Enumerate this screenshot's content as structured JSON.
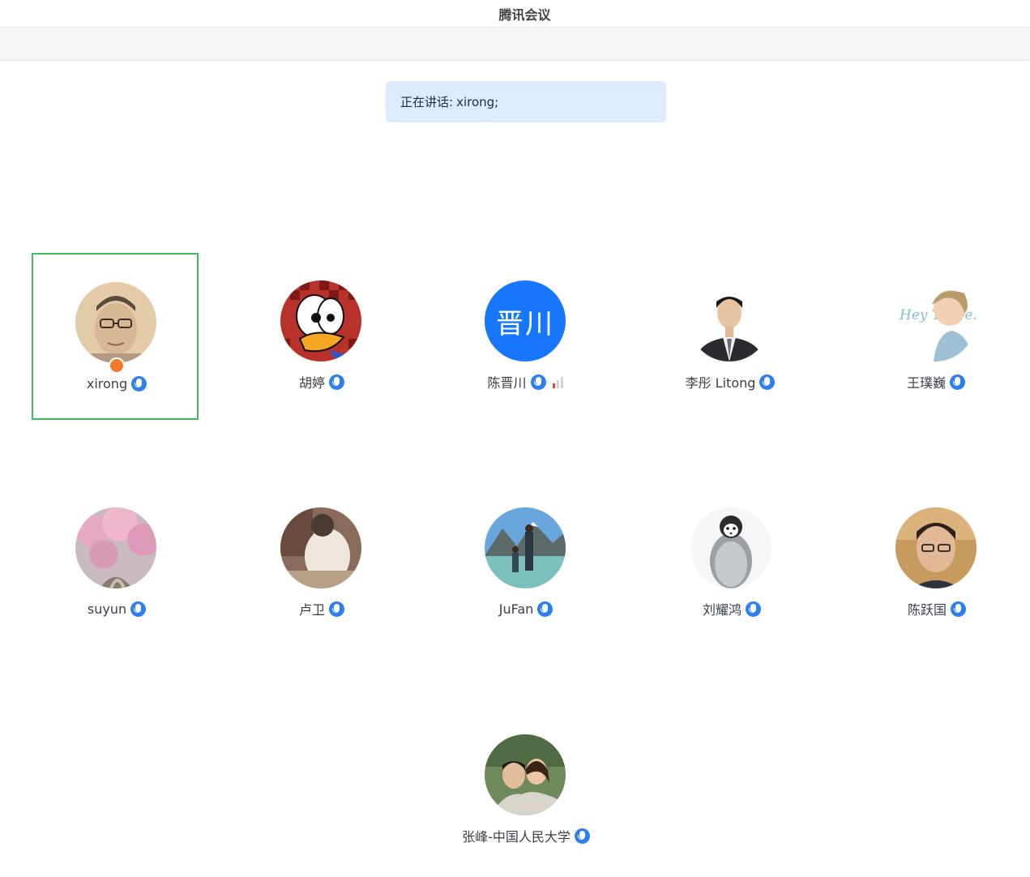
{
  "window": {
    "title": "腾讯会议"
  },
  "speaking": {
    "prefix": "正在讲话:",
    "names": "xirong;"
  },
  "participants": [
    {
      "name": "xirong",
      "active": true,
      "host": true,
      "avatar": "portrait-man-glasses"
    },
    {
      "name": "胡婷",
      "avatar": "cartoon-duck"
    },
    {
      "name": "陈晋川",
      "avatar": "text-avatar",
      "avatar_text": "晋川",
      "avatar_color": "#1777ff",
      "signal": true
    },
    {
      "name": "李彤 Litong",
      "avatar": "portrait-man-suit"
    },
    {
      "name": "王璞巍",
      "avatar": "cartoon-hey-there",
      "avatar_text": "Hey There!"
    },
    {
      "name": "suyun",
      "avatar": "cherry-blossoms"
    },
    {
      "name": "卢卫",
      "avatar": "person-from-back"
    },
    {
      "name": "JuFan",
      "avatar": "lake-mountains"
    },
    {
      "name": "刘耀鸿",
      "avatar": "penguin-chick"
    },
    {
      "name": "陈跃国",
      "avatar": "portrait-man-rendered"
    },
    {
      "name": "张峰-中国人民大学",
      "avatar": "couple-portrait"
    }
  ],
  "colors": {
    "accent": "#2d7ff0",
    "active_border": "#3dbd60",
    "speaking_bg": "#dcebff",
    "host_badge": "#f07b2a"
  }
}
